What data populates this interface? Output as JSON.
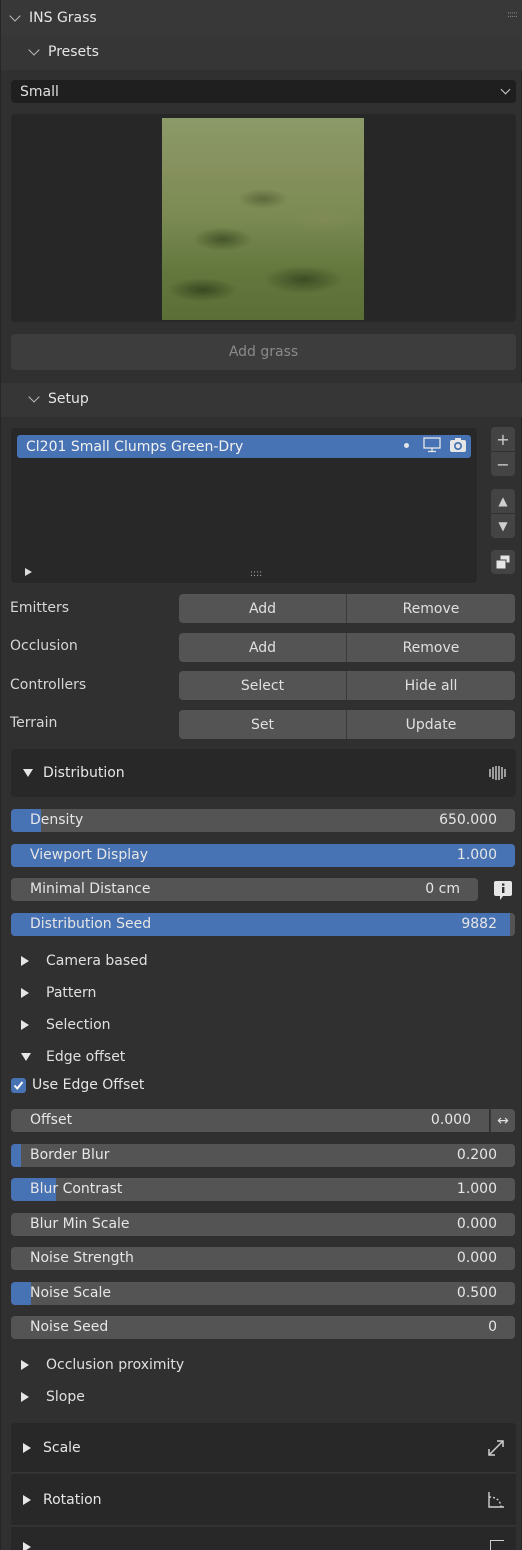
{
  "panel": {
    "title": "INS Grass",
    "grip_icon": "drag-grip-icon"
  },
  "presets": {
    "title": "Presets",
    "selected": "Small",
    "preview_alt": "grass preview",
    "add_button": "Add grass"
  },
  "setup": {
    "title": "Setup",
    "list_items": [
      {
        "name": "Cl201 Small Clumps Green-Dry",
        "selected": true,
        "icons": [
          "dot-icon",
          "monitor-icon",
          "camera-icon"
        ]
      }
    ],
    "side_buttons": [
      {
        "icon": "plus-icon",
        "glyph": "+"
      },
      {
        "icon": "minus-icon",
        "glyph": "−"
      },
      {
        "icon": "arrow-up-icon",
        "glyph": "▲"
      },
      {
        "icon": "arrow-down-icon",
        "glyph": "▼"
      },
      {
        "icon": "copy-stack-icon",
        "glyph": "❐"
      }
    ],
    "rows": [
      {
        "label": "Emitters",
        "left": "Add",
        "right": "Remove"
      },
      {
        "label": "Occlusion",
        "left": "Add",
        "right": "Remove"
      },
      {
        "label": "Controllers",
        "left": "Select",
        "right": "Hide all"
      },
      {
        "label": "Terrain",
        "left": "Set",
        "right": "Update"
      }
    ]
  },
  "distribution": {
    "title": "Distribution",
    "fields": [
      {
        "label": "Density",
        "value": "650.000",
        "fill_fraction": 0.06
      },
      {
        "label": "Viewport Display",
        "value": "1.000",
        "fill_fraction": 1.0
      },
      {
        "label": "Minimal Distance",
        "value": "0 cm",
        "fill_fraction": 0.0
      },
      {
        "label": "Distribution Seed",
        "value": "9882",
        "fill_fraction": 0.99
      }
    ],
    "subsections": [
      {
        "label": "Camera based",
        "expanded": false
      },
      {
        "label": "Pattern",
        "expanded": false
      },
      {
        "label": "Selection",
        "expanded": false
      },
      {
        "label": "Edge offset",
        "expanded": true
      }
    ],
    "edge_offset": {
      "use_label": "Use Edge Offset",
      "use_checked": true,
      "fields": [
        {
          "label": "Offset",
          "value": "0.000",
          "fill_fraction": 0.0
        },
        {
          "label": "Border Blur",
          "value": "0.200",
          "fill_fraction": 0.02
        },
        {
          "label": "Blur Contrast",
          "value": "1.000",
          "fill_fraction": 0.09
        },
        {
          "label": "Blur Min Scale",
          "value": "0.000",
          "fill_fraction": 0.0
        },
        {
          "label": "Noise Strength",
          "value": "0.000",
          "fill_fraction": 0.0
        },
        {
          "label": "Noise Scale",
          "value": "0.500",
          "fill_fraction": 0.04
        },
        {
          "label": "Noise Seed",
          "value": "0",
          "fill_fraction": 0.0
        }
      ]
    },
    "more_subsections": [
      {
        "label": "Occlusion proximity",
        "expanded": false
      },
      {
        "label": "Slope",
        "expanded": false
      }
    ]
  },
  "panels_below": [
    {
      "label": "Scale",
      "icon": "scale-arrows-icon"
    },
    {
      "label": "Rotation",
      "icon": "rotation-angle-icon"
    },
    {
      "label": "",
      "icon": "partial-icon"
    }
  ],
  "colors": {
    "accent": "#4772b3",
    "background": "#303030",
    "field": "#545454"
  }
}
